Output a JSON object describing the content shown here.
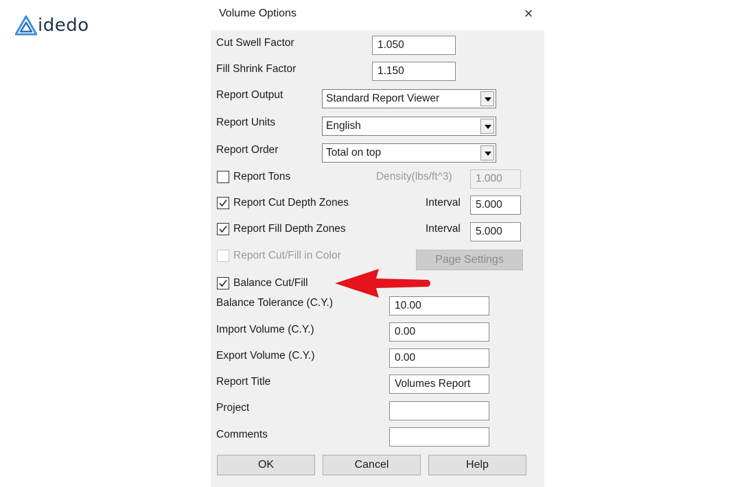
{
  "logo": {
    "text": "idedo",
    "mark": "A-logo-icon"
  },
  "dialog": {
    "title": "Volume Options",
    "close_icon": "×",
    "fields": {
      "cut_swell_factor": {
        "label": "Cut Swell Factor",
        "value": "1.050"
      },
      "fill_shrink_factor": {
        "label": "Fill Shrink Factor",
        "value": "1.150"
      },
      "report_output": {
        "label": "Report Output",
        "value": "Standard Report Viewer"
      },
      "report_units": {
        "label": "Report Units",
        "value": "English"
      },
      "report_order": {
        "label": "Report Order",
        "value": "Total on top"
      },
      "report_tons": {
        "label": "Report Tons",
        "checked": false
      },
      "density": {
        "label": "Density(lbs/ft^3)",
        "value": "1.000"
      },
      "report_cut_depth_zones": {
        "label": "Report Cut Depth Zones",
        "checked": true
      },
      "cut_interval": {
        "label": "Interval",
        "value": "5.000"
      },
      "report_fill_depth_zones": {
        "label": "Report Fill Depth Zones",
        "checked": true
      },
      "fill_interval": {
        "label": "Interval",
        "value": "5.000"
      },
      "report_cut_fill_color": {
        "label": "Report Cut/Fill in Color",
        "checked": false
      },
      "page_settings": {
        "label": "Page Settings"
      },
      "balance_cut_fill": {
        "label": "Balance Cut/Fill",
        "checked": true
      },
      "balance_tolerance": {
        "label": "Balance Tolerance (C.Y.)",
        "value": "10.00"
      },
      "import_volume": {
        "label": "Import Volume (C.Y.)",
        "value": "0.00"
      },
      "export_volume": {
        "label": "Export Volume (C.Y.)",
        "value": "0.00"
      },
      "report_title": {
        "label": "Report Title",
        "value": "Volumes Report"
      },
      "project": {
        "label": "Project",
        "value": ""
      },
      "comments": {
        "label": "Comments",
        "value": ""
      }
    },
    "buttons": {
      "ok": "OK",
      "cancel": "Cancel",
      "help": "Help"
    }
  },
  "annotation": {
    "arrow_color": "#e3141b"
  }
}
